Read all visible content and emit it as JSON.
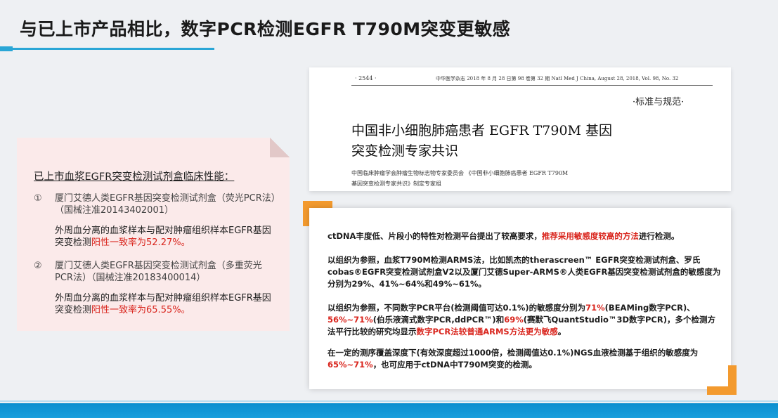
{
  "title": "与已上市产品相比，数字PCR检测EGFR T790M突变更敏感",
  "left_card": {
    "heading": "已上市血浆EGFR突变检测试剂盒临床性能：",
    "items": [
      {
        "num": "①",
        "text": "厦门艾德人类EGFR基因突变检测试剂盒（荧光PCR法）（国械注准20143402001）",
        "sub_prefix": "外周血分离的血浆样本与配对肿瘤组织样本EGFR基因突变检测",
        "sub_highlight": "阳性一致率为52.27%。"
      },
      {
        "num": "②",
        "text": "厦门艾德人类EGFR基因突变检测试剂盒（多重荧光PCR法）（国械注准20183400014）",
        "sub_prefix": "外周血分离的血浆样本与配对肿瘤组织样本EGFR基因突变检测",
        "sub_highlight": "阳性一致率为65.55%。"
      }
    ]
  },
  "article": {
    "page": "· 2544 ·",
    "journal": "中华医学杂志 2018 年 8 月 28 日第 98 卷第 32 期  Natl Med J China, August 28, 2018, Vol. 98, No. 32",
    "section": "·标准与规范·",
    "title_line1": "中国非小细胞肺癌患者 EGFR T790M 基因",
    "title_line2": "突变检测专家共识",
    "authors": "中国临床肿瘤学会肿瘤生物标志物专家委员会  《中国非小细胞肺癌患者 EGFR T790M",
    "authors2": "基因突变检测专家共识》制定专家组"
  },
  "right_card": {
    "p1_text": "ctDNA丰度低、片段小的特性对检测平台提出了较高要求，",
    "p1_red": "推荐采用敏感度较高的方法",
    "p1_tail": "进行检测。",
    "p2": "以组织为参照，血浆T790M检测ARMS法，比如凯杰的therascreen™ EGFR突变检测试剂盒、罗氏cobas®EGFR突变检测试剂盒V2以及厦门艾德Super-ARMS®人类EGFR基因突变检测试剂盒的敏感度为分别为29%、41%~64%和49%~61%。",
    "p3_a": "以组织为参照，不同数字PCR平台(检测阈值可达0.1%)的敏感度分别为",
    "p3_r1": "71%",
    "p3_b": "(BEAMing数字PCR)、",
    "p3_r2": "56%~71%",
    "p3_c": "(伯乐液滴式数字PCR,ddPCR™)和",
    "p3_r3": "69%",
    "p3_d": "(赛默飞QuantStudio™3D数字PCR)，多个检测方法平行比较的研究均显示",
    "p3_r4": "数字PCR法较普通ARMS方法更为敏感",
    "p3_e": "。",
    "p4_a": "在一定的测序覆盖深度下(有效深度超过1000倍，检测阈值达0.1%)NGS血液检测基于组织的敏感度为",
    "p4_r": "65%~71%",
    "p4_b": "，也可应用于ctDNA中T790M突变的检测。"
  },
  "colors": {
    "accent_blue": "#2aa6d6",
    "accent_orange": "#f39a2e",
    "highlight_red": "#d9251d"
  }
}
